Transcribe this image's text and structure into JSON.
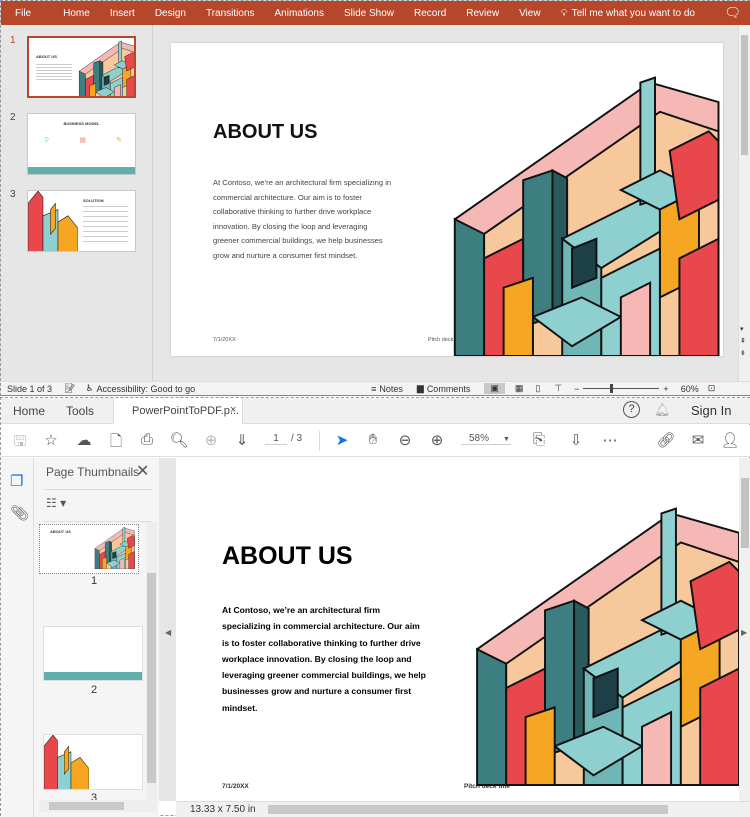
{
  "ppt": {
    "ribbon_tabs": [
      "File",
      "Home",
      "Insert",
      "Design",
      "Transitions",
      "Animations",
      "Slide Show",
      "Record",
      "Review",
      "View"
    ],
    "tell_me": "Tell me what you want to do",
    "slide_numbers": [
      "1",
      "2",
      "3"
    ],
    "thumb_titles": [
      "ABOUT US",
      "BUSINESS MODEL",
      "SOLUTION"
    ],
    "slide": {
      "title": "ABOUT US",
      "body": "At Contoso, we’re an architectural firm specializing in commercial architecture. Our aim is to foster collaborative thinking to further drive workplace innovation. By closing the loop and leveraging greener commercial buildings, we help businesses grow and nurture a consumer first mindset.",
      "date": "7/1/20XX",
      "footer": "Pitch deck title"
    },
    "status": {
      "slide_of": "Slide 1 of 3",
      "accessibility": "Accessibility: Good to go",
      "notes": "Notes",
      "comments": "Comments",
      "zoom": "60%"
    }
  },
  "acrobat": {
    "tabs": {
      "home": "Home",
      "tools": "Tools",
      "doc": "PowerPointToPDF.p...",
      "sign_in": "Sign In"
    },
    "toolbar": {
      "page_current": "1",
      "page_total": "/ 3",
      "zoom": "58%"
    },
    "panel": {
      "title": "Page Thumbnails",
      "page_labels": [
        "1",
        "2",
        "3"
      ]
    },
    "page": {
      "title": "ABOUT US",
      "body": "At Contoso, we’re an architectural firm specializing in commercial architecture. Our aim is to foster collaborative thinking to further drive workplace innovation. By closing the loop and leveraging greener commercial buildings, we help businesses grow and nurture a consumer first mindset.",
      "date": "7/1/20XX",
      "footer": "Pitch deck title"
    },
    "page_size": "13.33 x 7.50 in"
  },
  "colors": {
    "ppt_accent": "#b7472a",
    "teal": "#8ecfcf",
    "dark_teal": "#3d7f80",
    "red": "#e8474c",
    "pink": "#f5b8b5",
    "orange": "#f5a623",
    "peach": "#f7c89b",
    "acrobat_blue": "#1473e6"
  }
}
